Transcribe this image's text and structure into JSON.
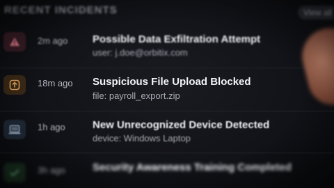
{
  "header": {
    "title": "RECENT INCIDENTS",
    "view_all_label": "View all"
  },
  "incidents": [
    {
      "time": "2m ago",
      "title": "Possible Data Exfiltration Attempt",
      "detail": "user: j.doe@orbitix.com",
      "icon": "warning-triangle-icon",
      "tile_color": "#3a1e27",
      "icon_color": "#e07a8c"
    },
    {
      "time": "18m ago",
      "title": "Suspicious File Upload Blocked",
      "detail": "file: payroll_export.zip",
      "icon": "upload-icon",
      "tile_color": "#3b2a17",
      "icon_color": "#e6a55a"
    },
    {
      "time": "1h ago",
      "title": "New Unrecognized Device Detected",
      "detail": "device: Windows Laptop",
      "icon": "laptop-icon",
      "tile_color": "#1f2a38",
      "icon_color": "#9fb4cc"
    },
    {
      "time": "3h ago",
      "title": "Security Awareness Training Completed",
      "icon": "check-icon",
      "tile_color": "#1b3322",
      "icon_color": "#6fc28a"
    }
  ]
}
